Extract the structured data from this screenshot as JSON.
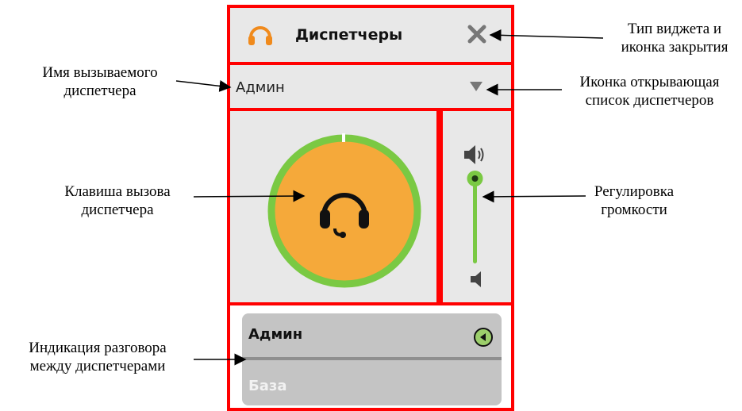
{
  "widget": {
    "title": "Диспетчеры",
    "selected_dispatcher": "Админ",
    "call_button_icon": "headset-icon",
    "volume_level": 0.95,
    "talk_indicator": {
      "from": "Админ",
      "to": "База",
      "status_icon": "play-circle-icon"
    }
  },
  "annotations": {
    "widget_type_and_close_line1": "Тип виджета и",
    "widget_type_and_close_line2": "иконка закрытия",
    "dispatcher_name_line1": "Имя вызываемого",
    "dispatcher_name_line2": "диспетчера",
    "dropdown_icon_line1": "Иконка открывающая",
    "dropdown_icon_line2": "список диспетчеров",
    "call_key_line1": "Клавиша вызова",
    "call_key_line2": "диспетчера",
    "volume_line1": "Регулировка",
    "volume_line2": "громкости",
    "talk_indication_line1": "Индикация разговора",
    "talk_indication_line2": "между диспетчерами"
  },
  "colors": {
    "highlight": "#ff0000",
    "accent_orange": "#f5a93a",
    "ring_green": "#7ac943",
    "panel": "#e8e8e8"
  }
}
